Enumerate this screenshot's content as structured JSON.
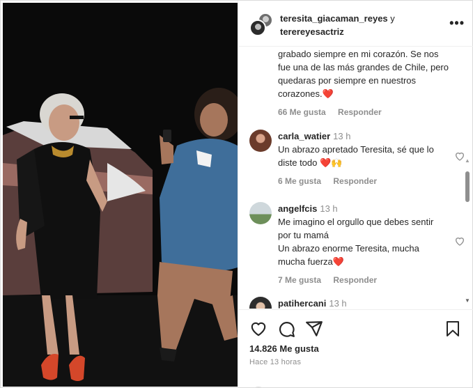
{
  "post": {
    "author_primary": "teresita_giacaman_reyes",
    "connector": "y",
    "author_secondary": "terereyesactriz",
    "more_label": "•••"
  },
  "comments": [
    {
      "text": "grabado siempre en mi corazón. Se nos fue una de las más grandes de Chile, pero quedaras por siempre en nuestros corazones.",
      "emoji": "❤️",
      "likes": "66 Me gusta",
      "reply": "Responder"
    },
    {
      "user": "carla_watier",
      "time": "13 h",
      "text": "Un abrazo apretado Teresita, sé que lo diste todo",
      "emoji": "❤️🙌",
      "likes": "6 Me gusta",
      "reply": "Responder"
    },
    {
      "user": "angelfcis",
      "time": "13 h",
      "text": "Me imagino el orgullo que debes sentir por tu mamá\nUn abrazo enorme Teresita, mucha mucha fuerza",
      "emoji": "❤️",
      "likes": "7 Me gusta",
      "reply": "Responder"
    },
    {
      "user": "patihercani",
      "time": "13 h"
    }
  ],
  "footer": {
    "likes": "14.826 Me gusta",
    "time": "Hace 13 horas"
  },
  "icons": [
    "like-icon",
    "comment-icon",
    "share-icon",
    "save-icon",
    "more-icon"
  ],
  "colors": {
    "text": "#262626",
    "muted": "#8e8e8e",
    "heart": "#e0245e",
    "border": "#efefef"
  }
}
